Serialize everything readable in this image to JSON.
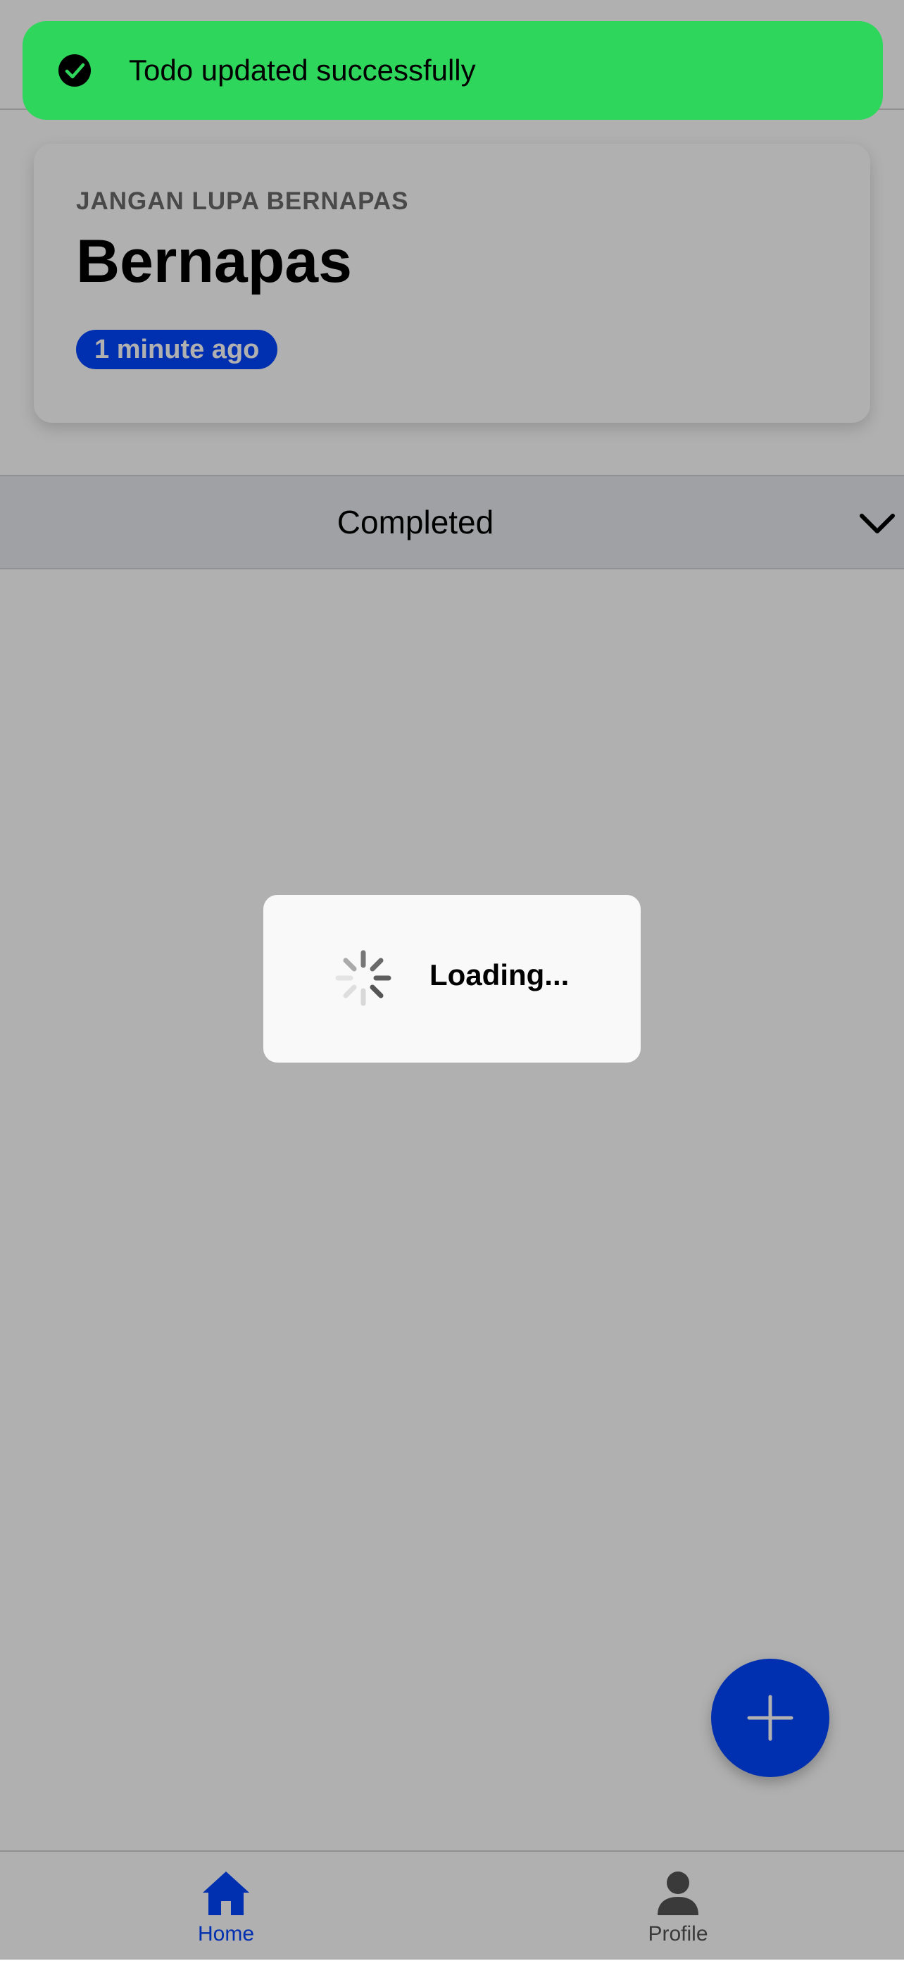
{
  "toast": {
    "message": "Todo updated successfully",
    "icon": "check-circle-icon",
    "color": "#2ed65c"
  },
  "todo": {
    "subtitle": "JANGAN LUPA BERNAPAS",
    "title": "Bernapas",
    "time_badge": "1 minute ago"
  },
  "section": {
    "title": "Completed",
    "icon": "chevron-down-icon"
  },
  "loading": {
    "text": "Loading...",
    "icon": "spinner-icon"
  },
  "fab": {
    "icon": "plus-icon"
  },
  "tabs": [
    {
      "label": "Home",
      "icon": "home-icon",
      "active": true
    },
    {
      "label": "Profile",
      "icon": "person-icon",
      "active": false
    }
  ],
  "colors": {
    "accent": "#0044ff",
    "overlay": "rgba(0,0,0,0.31)",
    "toast": "#2ed65c"
  }
}
